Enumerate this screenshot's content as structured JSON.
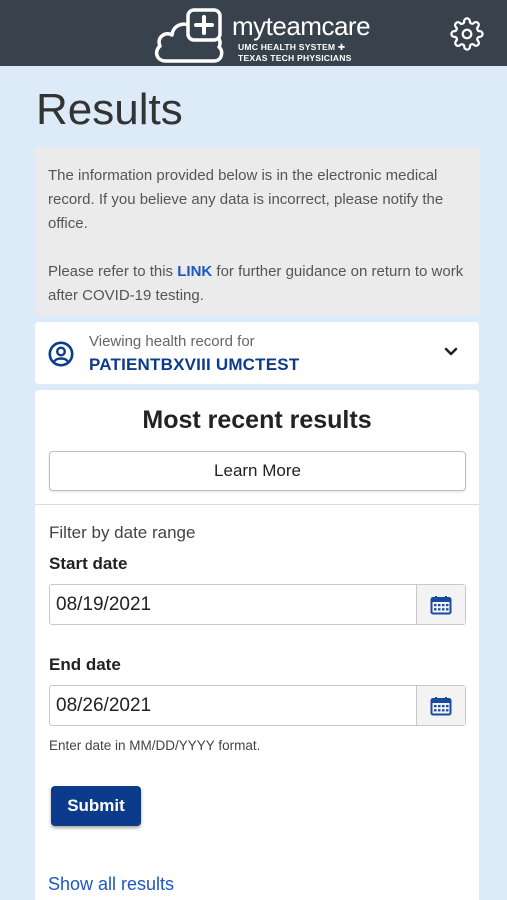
{
  "header": {
    "brand_name": "myteamcare",
    "brand_line1": "UMC HEALTH SYSTEM ✚",
    "brand_line2": "TEXAS TECH PHYSICIANS",
    "background": "#38424d"
  },
  "page": {
    "title": "Results",
    "background": "#dcebf7"
  },
  "notice": {
    "text1": "The information provided below is in the electronic medical record. If you believe any data is incorrect, please notify the office.",
    "text2_before": "Please refer to this ",
    "link_label": "LINK",
    "text2_after": " for further guidance on return to work after COVID-19 testing."
  },
  "patient": {
    "viewing_label": "Viewing health record for",
    "name": "PATIENTBXVIII UMCTEST",
    "icon": "user-circle-icon"
  },
  "results": {
    "title": "Most recent results",
    "learn_more_label": "Learn More",
    "filter_label": "Filter by date range",
    "start_label": "Start date",
    "start_value": "08/19/2021",
    "end_label": "End date",
    "end_value": "08/26/2021",
    "hint": "Enter date in MM/DD/YYYY format.",
    "submit_label": "Submit",
    "show_all_label": "Show all results"
  },
  "colors": {
    "primary": "#0d3b8c",
    "link": "#1d57c3"
  }
}
